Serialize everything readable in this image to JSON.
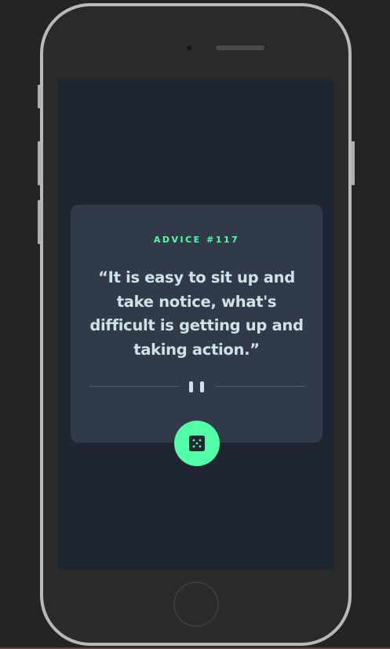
{
  "advice": {
    "label": "ADVICE #117",
    "quote": "“It is easy to sit up and take notice, what's difficult is getting up and taking action.”"
  },
  "colors": {
    "accent": "#52ffa8",
    "card": "#313a48",
    "screen": "#1f2631",
    "text": "#cee3e9",
    "divider": "#4f5d74"
  },
  "icons": {
    "divider": "pause-icon",
    "button": "dice-icon"
  }
}
